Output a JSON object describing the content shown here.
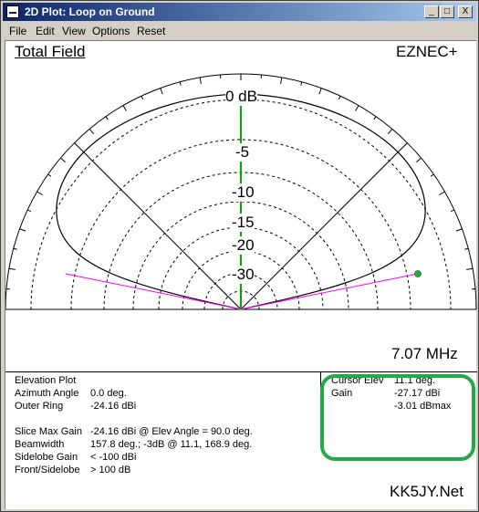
{
  "window": {
    "title": "2D Plot: Loop on Ground",
    "buttons": {
      "minimize": "_",
      "maximize": "□",
      "close": "X"
    }
  },
  "menu": [
    "File",
    "Edit",
    "View",
    "Options",
    "Reset"
  ],
  "plot": {
    "header_left": "Total Field",
    "header_right": "EZNEC+",
    "ring_labels": [
      "0 dB",
      "-5",
      "-10",
      "-15",
      "-20",
      "-30"
    ],
    "frequency": "7.07 MHz",
    "footer": "KK5JY.Net",
    "colors": {
      "accent_green": "#22aa44",
      "axis_green": "#00aa00",
      "cursor_magenta": "#ff00ff"
    }
  },
  "info_left": {
    "rows": [
      {
        "label": "Elevation Plot",
        "value": ""
      },
      {
        "label": "Azimuth Angle",
        "value": "0.0 deg."
      },
      {
        "label": "Outer Ring",
        "value": "-24.16 dBi"
      },
      {
        "label": "Slice Max Gain",
        "value": "-24.16 dBi @ Elev Angle = 90.0 deg."
      },
      {
        "label": "Beamwidth",
        "value": "157.8 deg.; -3dB @ 11.1, 168.9 deg."
      },
      {
        "label": "Sidelobe Gain",
        "value": "< -100 dBi"
      },
      {
        "label": "Front/Sidelobe",
        "value": "> 100 dB"
      }
    ]
  },
  "info_right": {
    "cursor_elev_label": "Cursor Elev",
    "cursor_elev_value": "11.1 deg.",
    "gain_label": "Gain",
    "gain_value": "-27.17 dBi",
    "gain_value2": "-3.01 dBmax"
  }
}
